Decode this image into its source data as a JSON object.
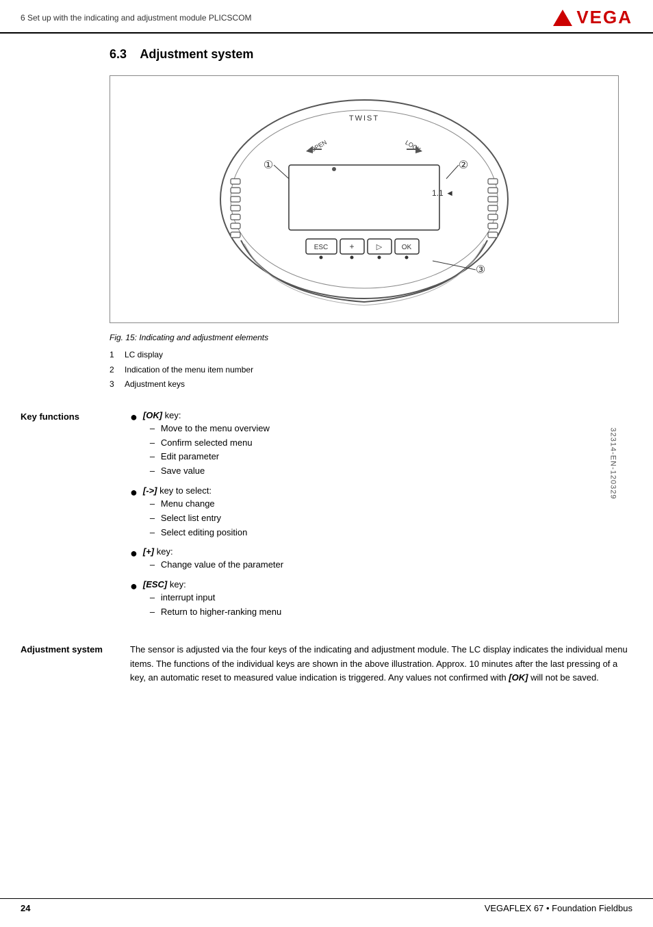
{
  "header": {
    "text": "6   Set up with the indicating and adjustment module PLICSCOM",
    "logo": "VEGA"
  },
  "section": {
    "number": "6.3",
    "title": "Adjustment system"
  },
  "figure": {
    "caption": "Fig. 15: Indicating and adjustment elements",
    "items": [
      {
        "num": "1",
        "text": "LC display"
      },
      {
        "num": "2",
        "text": "Indication of the menu item number"
      },
      {
        "num": "3",
        "text": "Adjustment keys"
      }
    ],
    "labels": {
      "twist": "TWIST",
      "open": "OPEN",
      "lock": "LOCK",
      "version": "1.1",
      "esc": "ESC",
      "plus": "+",
      "arrow": "▷",
      "ok": "OK",
      "num1": "①",
      "num2": "②",
      "num3": "③"
    }
  },
  "key_functions": {
    "label": "Key functions",
    "keys": [
      {
        "name": "[OK]",
        "suffix": " key:",
        "items": [
          "Move to the menu overview",
          "Confirm selected menu",
          "Edit parameter",
          "Save value"
        ]
      },
      {
        "name": "[->]",
        "suffix": " key to select:",
        "items": [
          "Menu change",
          "Select list entry",
          "Select editing position"
        ]
      },
      {
        "name": "[+]",
        "suffix": " key:",
        "items": [
          "Change value of the parameter"
        ]
      },
      {
        "name": "[ESC]",
        "suffix": " key:",
        "items": [
          "interrupt input",
          "Return to higher-ranking menu"
        ]
      }
    ]
  },
  "adjustment_system": {
    "label": "Adjustment system",
    "text": "The sensor is adjusted via the four keys of the indicating and adjustment module. The LC display indicates the individual menu items. The functions of the individual keys are shown in the above illustration. Approx. 10 minutes after the last pressing of a key, an automatic reset to measured value indication is triggered. Any values not confirmed with ",
    "bold_italic": "[OK]",
    "text_end": " will not be saved."
  },
  "footer": {
    "page": "24",
    "product": "VEGAFLEX 67 • Foundation Fieldbus"
  },
  "doc_number": "32314-EN-120329"
}
